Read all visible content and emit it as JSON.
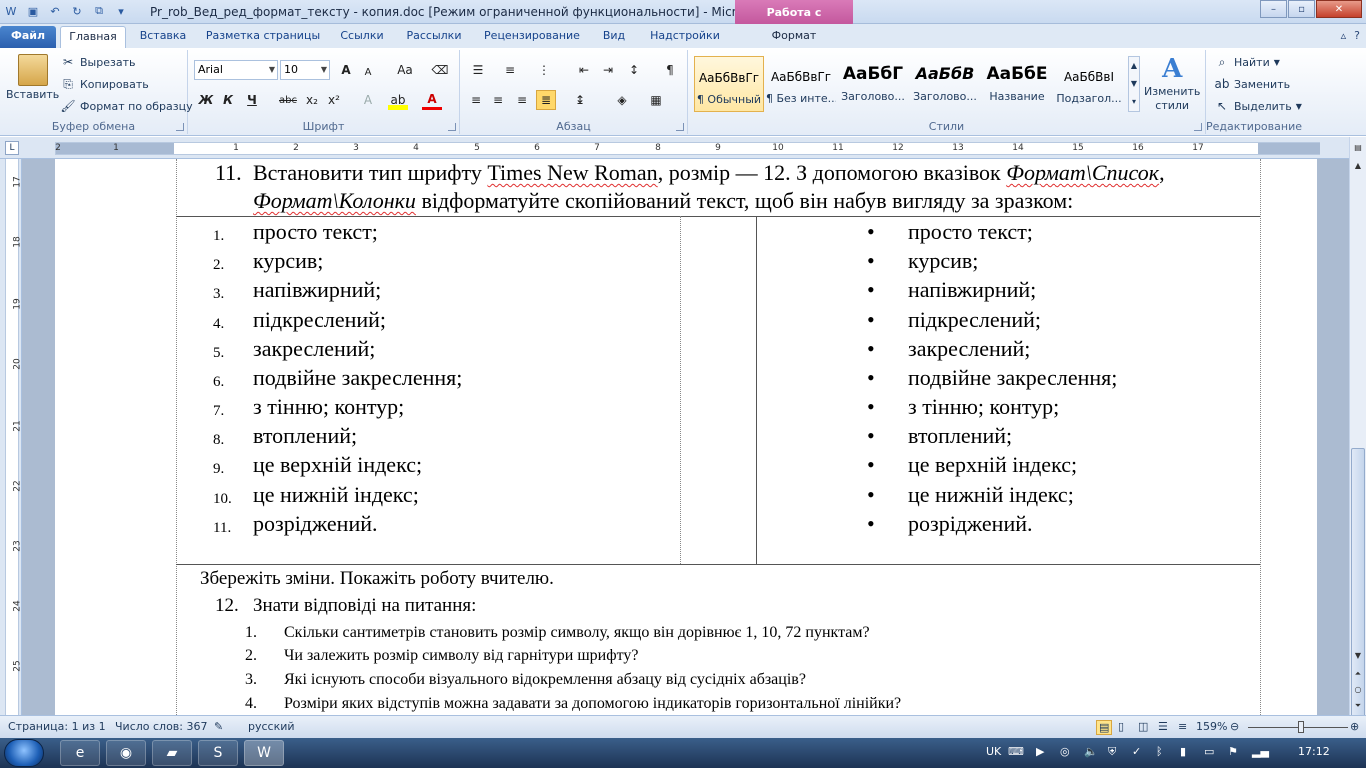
{
  "titlebar": {
    "title": "Pr_rob_Вед_ред_формат_тексту - копия.doc [Режим ограниченной функциональности] - Microsoft W...",
    "context_tab": "Работа с рисунками",
    "controls": {
      "minimize": "–",
      "maximize": "▫",
      "close": "✕"
    }
  },
  "tabs": {
    "file": "Файл",
    "home": "Главная",
    "insert": "Вставка",
    "layout": "Разметка страницы",
    "refs": "Ссылки",
    "mailings": "Рассылки",
    "review": "Рецензирование",
    "view": "Вид",
    "addins": "Надстройки",
    "format": "Формат"
  },
  "ribbon": {
    "clipboard": {
      "paste": "Вставить",
      "cut": "Вырезать",
      "copy": "Копировать",
      "painter": "Формат по образцу",
      "label": "Буфер обмена"
    },
    "font": {
      "name": "Arial",
      "size": "10",
      "label": "Шрифт",
      "change_case": "Aa",
      "bold": "Ж",
      "italic": "К",
      "underline": "Ч",
      "strike": "abc",
      "sub": "x₂",
      "sup": "x²",
      "grow": "A",
      "shrink": "A",
      "highlight": "ab",
      "color": "A"
    },
    "paragraph": {
      "label": "Абзац"
    },
    "styles": {
      "label": "Стили",
      "items": [
        {
          "sample": "АаБбВвГг",
          "name": "¶ Обычный"
        },
        {
          "sample": "АаБбВвГг",
          "name": "¶ Без инте..."
        },
        {
          "sample": "АаБбГ",
          "name": "Заголово..."
        },
        {
          "sample": "АаБбВ",
          "name": "Заголово..."
        },
        {
          "sample": "АаБбЕ",
          "name": "Название"
        },
        {
          "sample": "АаБбВвІ",
          "name": "Подзагол..."
        }
      ],
      "change": "Изменить",
      "change2": "стили"
    },
    "editing": {
      "find": "Найти",
      "replace": "Заменить",
      "select": "Выделить",
      "label": "Редактирование"
    }
  },
  "ruler": {
    "h_numbers": [
      "2",
      "1",
      "1",
      "2",
      "3",
      "4",
      "5",
      "6",
      "7",
      "8",
      "9",
      "10",
      "11",
      "12",
      "13",
      "14",
      "15",
      "16",
      "17"
    ],
    "v_numbers": [
      "17",
      "18",
      "19",
      "20",
      "21",
      "22",
      "23",
      "24",
      "25"
    ],
    "corner": "L"
  },
  "document": {
    "item11_num": "11.",
    "item11_line1_a": "Встановити тип шрифту ",
    "item11_times": "Times New Roman",
    "item11_line1_b": ", розмір — 12. З допомогою вказівок ",
    "item11_fmt_list": "Формат\\Список",
    "item11_line1_c": ",",
    "item11_fmt_cols": "Формат\\Колонки",
    "item11_line2_b": " відформатуйте скопійований  текст, щоб він набув вигляду за зразком:",
    "list_items": [
      "просто текст;",
      "курсив;",
      "напівжирний;",
      "підкреслений;",
      "закреслений;",
      "подвійне закреслення;",
      "з тінню; контур;",
      "втоплений;",
      "це верхній індекс;",
      "це нижній індекс;",
      "розріджений."
    ],
    "list_numbers": [
      "1.",
      "2.",
      "3.",
      "4.",
      "5.",
      "6.",
      "7.",
      "8.",
      "9.",
      "10.",
      "11."
    ],
    "bullet": "•",
    "save_line": "Збережіть зміни. Покажіть роботу вчителю.",
    "item12_num": "12.",
    "item12_text": "Знати відповіді на питання:",
    "questions": [
      {
        "num": "1.",
        "text": "Скільки сантиметрів становить розмір символу, якщо він дорівнює 1, 10, 72 пунктам?"
      },
      {
        "num": "2.",
        "text": "Чи залежить розмір символу від гарнітури шрифту?"
      },
      {
        "num": "3.",
        "text": "Які існують способи візуального відокремлення абзацу від сусідніх абзаців?"
      },
      {
        "num": "4.",
        "text": "Розміри яких відступів можна задавати за допомогою індикаторів горизонтальної лінійки?"
      }
    ]
  },
  "statusbar": {
    "page": "Страница: 1 из 1",
    "words": "Число слов: 367",
    "lang": "русский",
    "zoom": "159%"
  },
  "taskbar": {
    "lang": "UK",
    "time": "17:12"
  }
}
